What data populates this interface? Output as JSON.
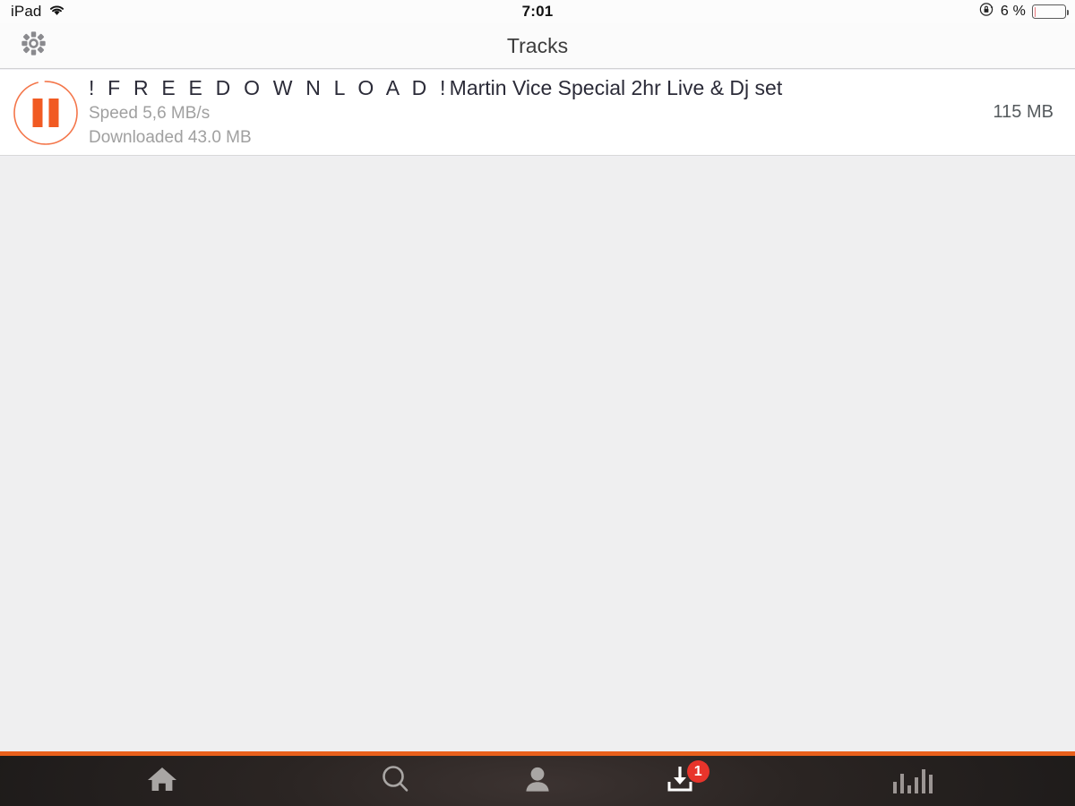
{
  "status_bar": {
    "carrier": "iPad",
    "wifi_icon": "wifi-icon",
    "time": "7:01",
    "rotation_lock_icon": "rotation-lock-icon",
    "battery_text": "6 %",
    "battery_percent": 6
  },
  "nav_bar": {
    "settings_icon": "gear-icon",
    "title": "Tracks"
  },
  "download": {
    "state_icon": "pause-icon",
    "progress_percent": 37,
    "title_spaced": "! F R E E   D O W N L O A D !",
    "title_rest": "Martin Vice Special 2hr Live & Dj set",
    "speed": "Speed 5,6 MB/s",
    "downloaded": "Downloaded 43.0 MB",
    "total_size": "115 MB",
    "accent_color": "#f15a22"
  },
  "tab_bar": {
    "accent_color": "#e8601c",
    "items": [
      {
        "name": "tab-home",
        "icon": "home-icon",
        "active": false
      },
      {
        "name": "tab-search",
        "icon": "search-icon",
        "active": false
      },
      {
        "name": "tab-profile",
        "icon": "person-icon",
        "active": false
      },
      {
        "name": "tab-downloads",
        "icon": "download-icon",
        "active": true,
        "badge": "1"
      },
      {
        "name": "tab-charts",
        "icon": "bar-chart-icon",
        "active": false
      }
    ]
  }
}
